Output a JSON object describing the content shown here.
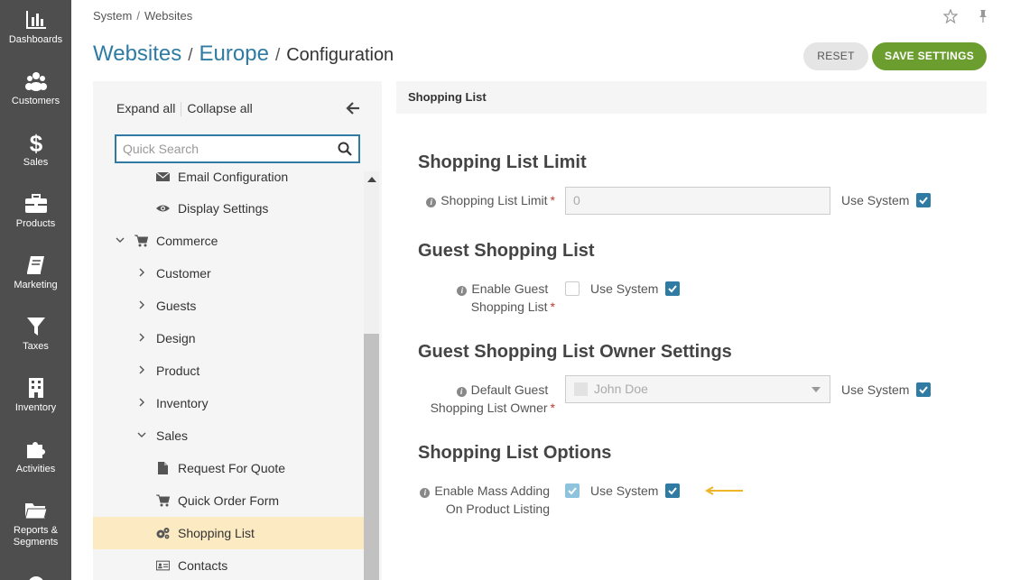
{
  "sidebar": {
    "items": [
      {
        "label": "Dashboards",
        "icon": "dashboards-icon"
      },
      {
        "label": "Customers",
        "icon": "customers-icon"
      },
      {
        "label": "Sales",
        "icon": "dollar-icon"
      },
      {
        "label": "Products",
        "icon": "briefcase-icon"
      },
      {
        "label": "Marketing",
        "icon": "book-icon"
      },
      {
        "label": "Taxes",
        "icon": "filter-icon"
      },
      {
        "label": "Inventory",
        "icon": "building-icon"
      },
      {
        "label": "Activities",
        "icon": "puzzle-icon"
      },
      {
        "label": "Reports &",
        "label2": "Segments",
        "icon": "folder-icon"
      }
    ]
  },
  "breadcrumb": {
    "items": [
      "System",
      "Websites"
    ],
    "separator": "/"
  },
  "title": {
    "part1": "Websites",
    "sep": "/",
    "part2": "Europe",
    "part3": "Configuration"
  },
  "header_icons": {
    "star": "star-icon",
    "pin": "pin-icon"
  },
  "buttons": {
    "reset": "Reset",
    "save": "Save Settings"
  },
  "tree": {
    "expand_all": "Expand all",
    "collapse_all": "Collapse all",
    "search_placeholder": "Quick Search",
    "items": [
      {
        "label": "Email Configuration",
        "icon": "envelope-icon",
        "level": 2
      },
      {
        "label": "Display Settings",
        "icon": "eye-icon",
        "level": 2
      },
      {
        "label": "Commerce",
        "icon": "cart-icon",
        "level": 1,
        "expanded": true
      },
      {
        "label": "Customer",
        "level": 2,
        "expanded": false
      },
      {
        "label": "Guests",
        "level": 2,
        "expanded": false
      },
      {
        "label": "Design",
        "level": 2,
        "expanded": false
      },
      {
        "label": "Product",
        "level": 2,
        "expanded": false
      },
      {
        "label": "Inventory",
        "level": 2,
        "expanded": false
      },
      {
        "label": "Sales",
        "level": 2,
        "expanded": true
      },
      {
        "label": "Request For Quote",
        "icon": "document-icon",
        "level": 3
      },
      {
        "label": "Quick Order Form",
        "icon": "cart-icon",
        "level": 3
      },
      {
        "label": "Shopping List",
        "icon": "gears-icon",
        "level": 3,
        "active": true
      },
      {
        "label": "Contacts",
        "icon": "contact-card-icon",
        "level": 3
      }
    ]
  },
  "section": {
    "header": "Shopping List",
    "groups": [
      {
        "title": "Shopping List Limit",
        "fields": [
          {
            "label_line1": "Shopping List Limit",
            "required": true,
            "value": "0",
            "use_system_label": "Use System",
            "use_system": true
          }
        ]
      },
      {
        "title": "Guest Shopping List",
        "fields": [
          {
            "label_line1": "Enable Guest",
            "label_line2": "Shopping List",
            "required": true,
            "checked": false,
            "use_system_label": "Use System",
            "use_system": true
          }
        ]
      },
      {
        "title": "Guest Shopping List Owner Settings",
        "fields": [
          {
            "label_line1": "Default Guest",
            "label_line2": "Shopping List Owner",
            "required": true,
            "value": "John Doe",
            "use_system_label": "Use System",
            "use_system": true
          }
        ]
      },
      {
        "title": "Shopping List Options",
        "fields": [
          {
            "label_line1": "Enable Mass Adding",
            "label_line2": "On Product Listing",
            "checked": true,
            "use_system_label": "Use System",
            "use_system": true
          }
        ]
      }
    ]
  },
  "colors": {
    "sidebar_bg": "#4e4e4e",
    "link": "#2f7ba3",
    "save_button": "#6b9e2e",
    "active_item": "#fcebc2",
    "checkbox": "#2f7ba3",
    "arrow_indicator": "#f0b428"
  }
}
